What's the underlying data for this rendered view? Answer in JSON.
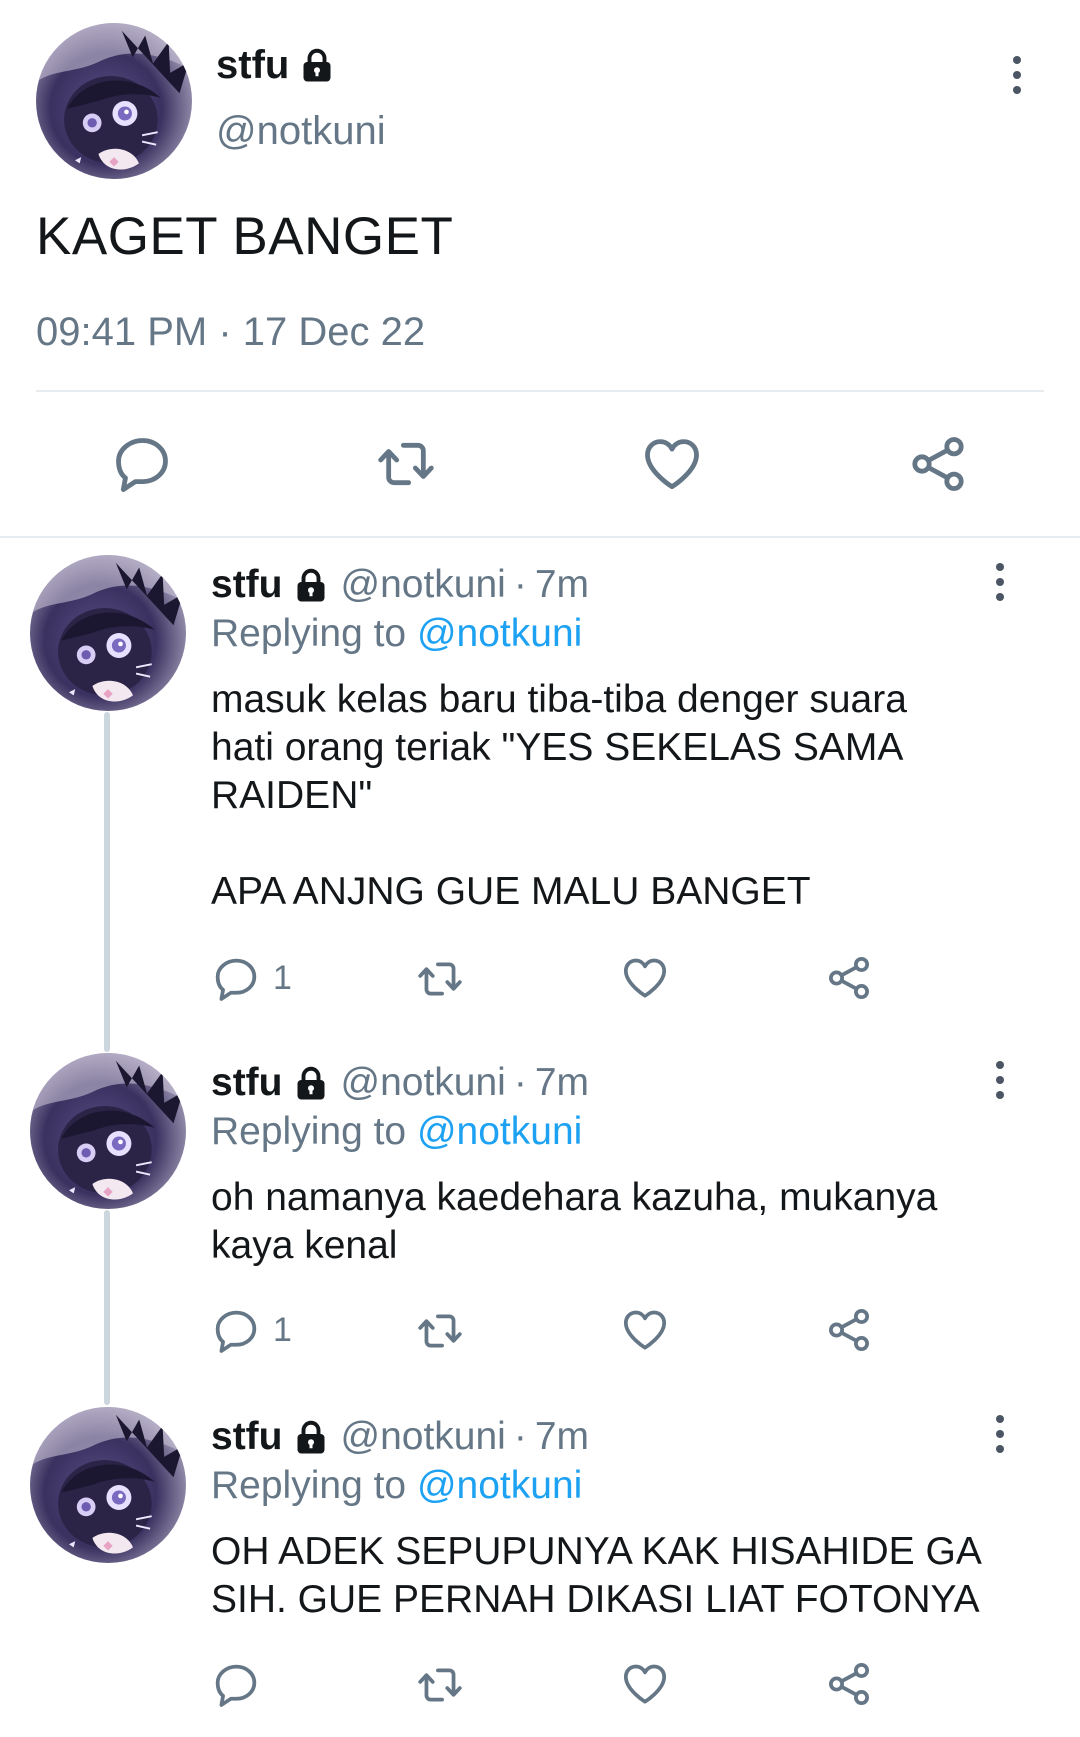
{
  "main_tweet": {
    "name": "stfu",
    "handle": "@notkuni",
    "text": "KAGET BANGET",
    "timestamp": "09:41 PM · 17 Dec 22",
    "actions": [
      "reply-icon",
      "retweet-icon",
      "like-icon",
      "share-icon"
    ]
  },
  "replies": [
    {
      "name": "stfu",
      "handle": "@notkuni",
      "dot": "·",
      "time": "7m",
      "replying_prefix": "Replying to ",
      "replying_to": "@notkuni",
      "text": "masuk kelas baru tiba-tiba denger suara\nhati orang teriak \"YES SEKELAS SAMA\nRAIDEN\"\n\nAPA ANJNG GUE MALU BANGET",
      "reply_count": "1"
    },
    {
      "name": "stfu",
      "handle": "@notkuni",
      "dot": "·",
      "time": "7m",
      "replying_prefix": "Replying to ",
      "replying_to": "@notkuni",
      "text": "oh namanya kaedehara kazuha, mukanya\nkaya kenal",
      "reply_count": "1"
    },
    {
      "name": "stfu",
      "handle": "@notkuni",
      "dot": "·",
      "time": "7m",
      "replying_prefix": "Replying to ",
      "replying_to": "@notkuni",
      "text": "OH ADEK SEPUPUNYA KAK HISAHIDE GA\nSIH. GUE PERNAH DIKASI LIAT FOTONYA",
      "reply_count": ""
    }
  ],
  "colors": {
    "text": "#14171a",
    "secondary": "#657786",
    "link": "#1da1f2",
    "divider": "#e6ecf0"
  }
}
